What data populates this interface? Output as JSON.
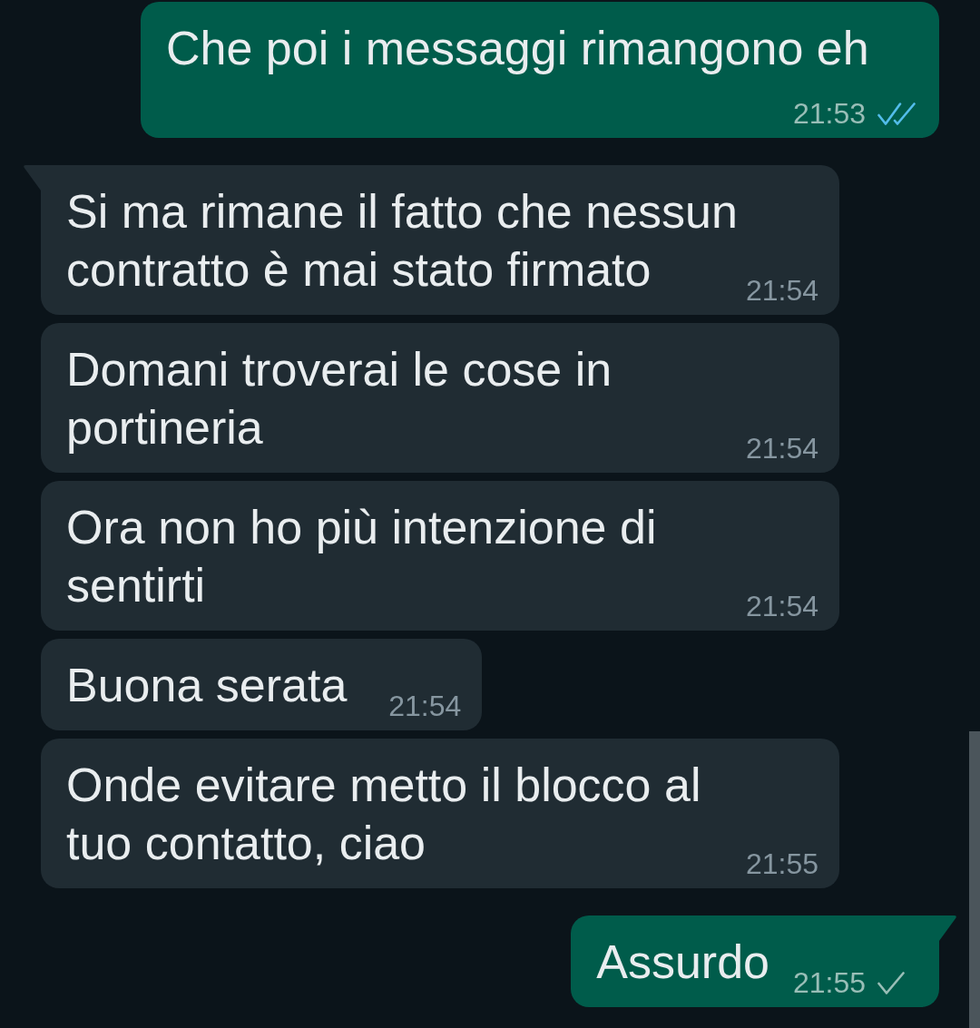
{
  "messages": [
    {
      "kind": "outgoing",
      "text": "Che poi i messaggi rimangono eh",
      "time": "21:53",
      "tail": false,
      "delivered": true,
      "read": true
    },
    {
      "kind": "incoming",
      "text": "Si ma rimane il fatto che nessun contratto è mai stato firmato",
      "time": "21:54",
      "tail": true
    },
    {
      "kind": "incoming",
      "text": "Domani troverai le cose in portineria",
      "time": "21:54",
      "tail": false
    },
    {
      "kind": "incoming",
      "text": "Ora non ho più intenzione di sentirti",
      "time": "21:54",
      "tail": false
    },
    {
      "kind": "incoming",
      "text": "Buona serata",
      "time": "21:54",
      "tail": false
    },
    {
      "kind": "incoming",
      "text": "Onde evitare metto il blocco al tuo contatto, ciao",
      "time": "21:55",
      "tail": false
    },
    {
      "kind": "outgoing",
      "text": "Assurdo",
      "time": "21:55",
      "tail": true,
      "delivered": false,
      "read": false
    }
  ]
}
